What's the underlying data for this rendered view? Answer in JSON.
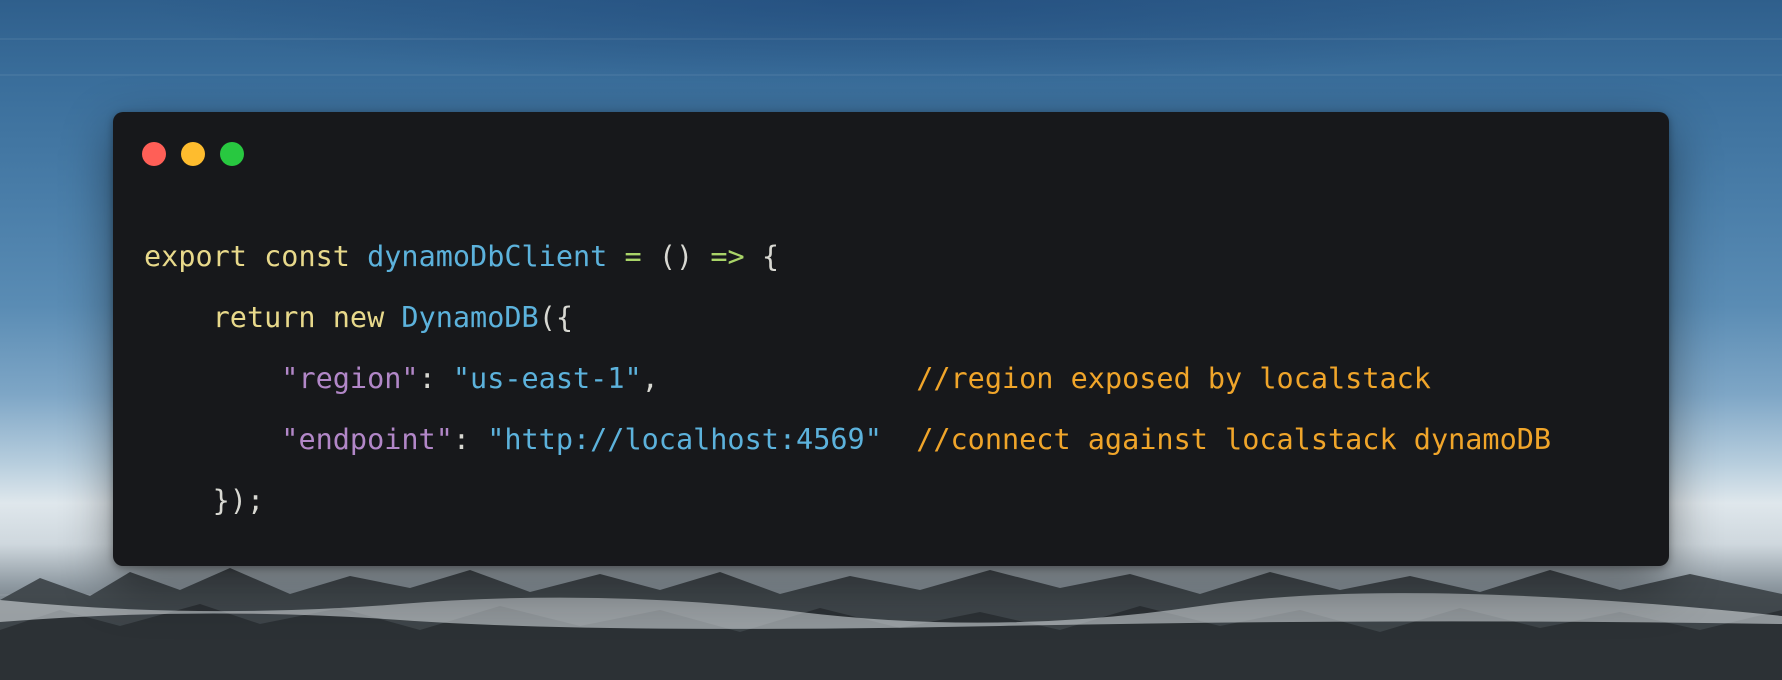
{
  "window": {
    "controls": {
      "close_color": "#ff5f57",
      "minimize_color": "#febc2e",
      "maximize_color": "#28c840"
    }
  },
  "code": {
    "line1": {
      "kw_export": "export",
      "sp1": " ",
      "kw_const": "const",
      "sp2": " ",
      "name": "dynamoDbClient",
      "sp3": " ",
      "eq": "=",
      "sp4": " ",
      "parens": "()",
      "sp5": " ",
      "arrow": "=>",
      "sp6": " ",
      "brace": "{"
    },
    "line2": {
      "indent": "    ",
      "kw_return": "return",
      "sp1": " ",
      "kw_new": "new",
      "sp2": " ",
      "cls": "DynamoDB",
      "open": "({"
    },
    "line3": {
      "indent": "        ",
      "key": "\"region\"",
      "colon": ": ",
      "value": "\"us-east-1\"",
      "comma": ",",
      "pad": "               ",
      "comment": "//region exposed by localstack"
    },
    "line4": {
      "indent": "        ",
      "key": "\"endpoint\"",
      "colon": ": ",
      "value": "\"http://localhost:4569\"",
      "pad": "  ",
      "comment": "//connect against localstack dynamoDB"
    },
    "line5": {
      "indent": "    ",
      "close": "});"
    }
  }
}
